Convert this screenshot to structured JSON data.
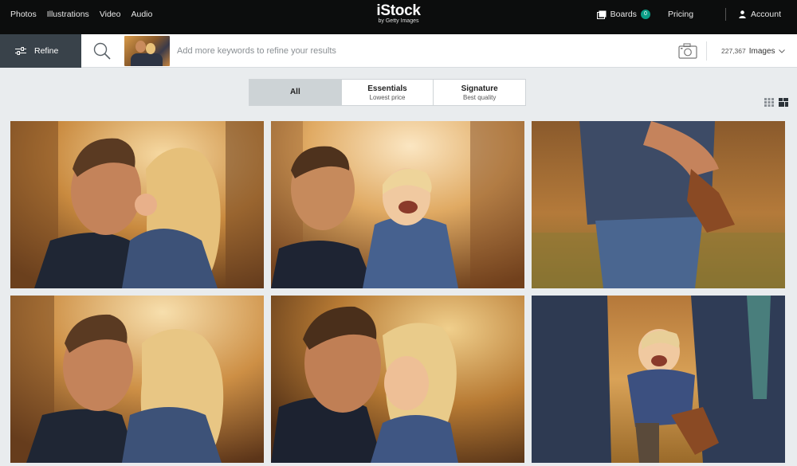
{
  "topnav": {
    "items": [
      "Photos",
      "Illustrations",
      "Video",
      "Audio"
    ],
    "logo": "iStock",
    "logo_sub": "by Getty Images",
    "boards_label": "Boards",
    "boards_count": "0",
    "pricing_label": "Pricing",
    "account_label": "Account"
  },
  "search": {
    "refine_label": "Refine",
    "placeholder": "Add more keywords to refine your results",
    "result_count": "227,367",
    "result_type": "Images"
  },
  "tabs": [
    {
      "title": "All",
      "subtitle": ""
    },
    {
      "title": "Essentials",
      "subtitle": "Lowest price"
    },
    {
      "title": "Signature",
      "subtitle": "Best quality"
    }
  ],
  "colors": {
    "topbar": "#0c0d0d",
    "refine_bg": "#39424a",
    "accent": "#0a9d86",
    "page_bg": "#e9ecee"
  },
  "images": [
    {
      "description": "father-kissing-daughter-cheek"
    },
    {
      "description": "father-and-laughing-toddler"
    },
    {
      "description": "father-holding-child-torso"
    },
    {
      "description": "father-kissing-daughter"
    },
    {
      "description": "father-and-daughter-touching-noses"
    },
    {
      "description": "child-swinging-between-parents"
    }
  ]
}
